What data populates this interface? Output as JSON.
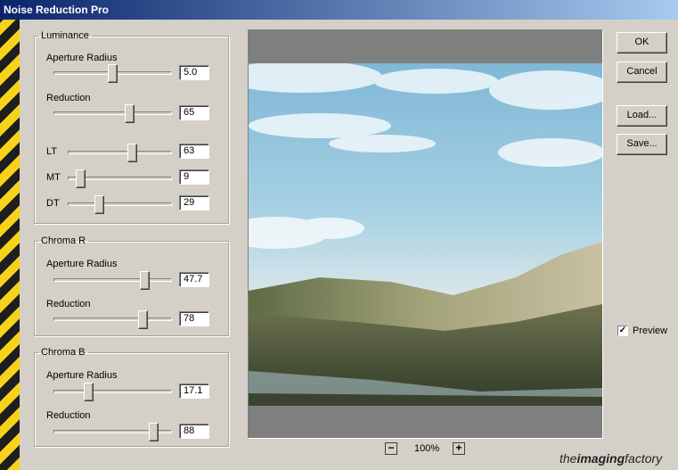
{
  "window": {
    "title": "Noise Reduction Pro"
  },
  "luminance": {
    "legend": "Luminance",
    "aperture_radius": {
      "label": "Aperture Radius",
      "value": "5.0",
      "level": 0.5
    },
    "reduction": {
      "label": "Reduction",
      "value": "65",
      "level": 0.65
    },
    "lt": {
      "label": "LT",
      "value": "63",
      "level": 0.63
    },
    "mt": {
      "label": "MT",
      "value": "9",
      "level": 0.09
    },
    "dt": {
      "label": "DT",
      "value": "29",
      "level": 0.29
    }
  },
  "chroma_r": {
    "legend": "Chroma R",
    "aperture_radius": {
      "label": "Aperture Radius",
      "value": "47.7",
      "level": 0.8
    },
    "reduction": {
      "label": "Reduction",
      "value": "78",
      "level": 0.78
    }
  },
  "chroma_b": {
    "legend": "Chroma B",
    "aperture_radius": {
      "label": "Aperture Radius",
      "value": "17.1",
      "level": 0.29
    },
    "reduction": {
      "label": "Reduction",
      "value": "88",
      "level": 0.88
    }
  },
  "buttons": {
    "ok": "OK",
    "cancel": "Cancel",
    "load": "Load...",
    "save": "Save..."
  },
  "preview": {
    "label": "Preview",
    "checked": true
  },
  "zoom": {
    "level": "100%",
    "minus": "−",
    "plus": "+"
  },
  "brand": {
    "prefix": "the",
    "bold": "imaging",
    "suffix": "factory"
  },
  "colors": {
    "title_start": "#0a246a",
    "title_end": "#a6caf0",
    "stripe_yellow": "#f6d21a",
    "stripe_black": "#1e1e1e"
  }
}
